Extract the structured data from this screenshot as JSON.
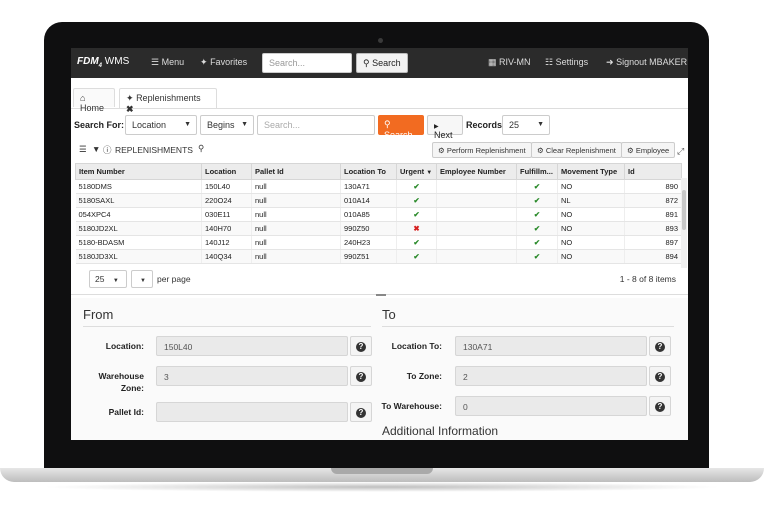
{
  "navbar": {
    "brand": "FDM",
    "brand_sub": "4",
    "brand_suffix": " WMS",
    "menu_label": "Menu",
    "favorites_label": "Favorites",
    "search_placeholder": "Search...",
    "search_button": "Search",
    "location_label": "RIV-MN",
    "settings_label": "Settings",
    "signout_label": "Signout MBAKER"
  },
  "tabs": [
    {
      "label": "Home"
    },
    {
      "label": "Replenishments"
    }
  ],
  "search_bar": {
    "search_for_label": "Search For:",
    "field_select": "Location",
    "operator_select": "Begins",
    "input_placeholder": "Search...",
    "search_button": "Search",
    "next_button": "Next",
    "records_label": "Records:",
    "records_value": "25"
  },
  "grid": {
    "title": "REPLENISHMENTS",
    "perform_button": "Perform Replenishment",
    "clear_button": "Clear Replenishment",
    "employee_button": "Employee",
    "columns": [
      "Item Number",
      "Location",
      "Pallet Id",
      "Location To",
      "Urgent",
      "Employee Number",
      "Fulfillm...",
      "Movement Type",
      "Id"
    ],
    "rows": [
      {
        "item": "5180DMS",
        "location": "150L40",
        "pallet": "null",
        "location_to": "130A71",
        "urgent": "check",
        "employee": "",
        "fulfill": "check",
        "movement": "NO",
        "id": "890"
      },
      {
        "item": "5180SAXL",
        "location": "220O24",
        "pallet": "null",
        "location_to": "010A14",
        "urgent": "check",
        "employee": "",
        "fulfill": "check",
        "movement": "NL",
        "id": "872"
      },
      {
        "item": "054XPC4",
        "location": "030E11",
        "pallet": "null",
        "location_to": "010A85",
        "urgent": "check",
        "employee": "",
        "fulfill": "check",
        "movement": "NO",
        "id": "891"
      },
      {
        "item": "5180JD2XL",
        "location": "140H70",
        "pallet": "null",
        "location_to": "990Z50",
        "urgent": "cross",
        "employee": "",
        "fulfill": "check",
        "movement": "NO",
        "id": "893"
      },
      {
        "item": "5180-BDASM",
        "location": "140J12",
        "pallet": "null",
        "location_to": "240H23",
        "urgent": "check",
        "employee": "",
        "fulfill": "check",
        "movement": "NO",
        "id": "897"
      },
      {
        "item": "5180JD3XL",
        "location": "140Q34",
        "pallet": "null",
        "location_to": "990Z51",
        "urgent": "check",
        "employee": "",
        "fulfill": "check",
        "movement": "NO",
        "id": "894"
      }
    ],
    "page_size": "25",
    "per_page_label": "per page",
    "items_summary": "1 - 8 of 8 items"
  },
  "form": {
    "from_title": "From",
    "to_title": "To",
    "location_label": "Location:",
    "location_value": "150L40",
    "warehouse_zone_label": "Warehouse Zone:",
    "warehouse_zone_value": "3",
    "pallet_id_label": "Pallet Id:",
    "pallet_id_value": "",
    "location_to_label": "Location To:",
    "location_to_value": "130A71",
    "to_zone_label": "To Zone:",
    "to_zone_value": "2",
    "to_warehouse_label": "To Warehouse:",
    "to_warehouse_value": "0",
    "additional_title": "Additional Information"
  }
}
